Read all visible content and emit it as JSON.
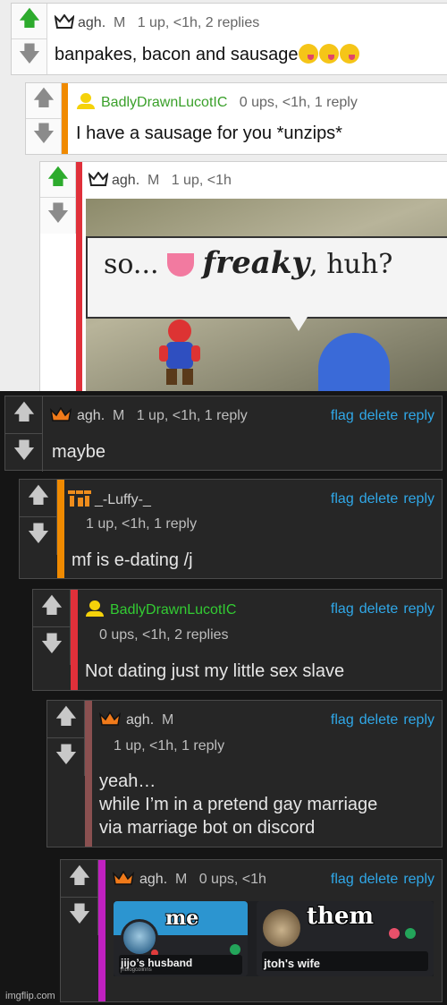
{
  "light_comments": [
    {
      "user": "agh.",
      "mod": "M",
      "meta": "1 up, <1h, 2 replies",
      "text": "banpakes, bacon and sausage"
    },
    {
      "user": "BadlyDrawnLucotIC",
      "meta": "0 ups, <1h, 1 reply",
      "text": "I have a sausage for you *unzips*"
    },
    {
      "user": "agh.",
      "mod": "M",
      "meta": "1 up, <1h",
      "meme_text_a": "so...",
      "meme_text_b": "freaky",
      "meme_text_c": ", huh?"
    }
  ],
  "dark_comments": [
    {
      "user": "agh.",
      "mod": "M",
      "meta": "1 up, <1h, 1 reply",
      "text": "maybe"
    },
    {
      "user": "_-Luffy-_",
      "meta": "1 up, <1h, 1 reply",
      "text": "mf is e-dating /j"
    },
    {
      "user": "BadlyDrawnLucotIC",
      "meta": "0 ups, <1h, 2 replies",
      "text": "Not dating just my little sex slave"
    },
    {
      "user": "agh.",
      "mod": "M",
      "meta": "1 up, <1h, 1 reply",
      "text_lines": [
        "yeah…",
        "while I’m in a pretend gay marriage",
        "via marriage bot on discord"
      ]
    },
    {
      "user": "agh.",
      "mod": "M",
      "meta": "0 ups, <1h"
    }
  ],
  "actions": {
    "flag": "flag",
    "delete": "delete",
    "reply": "reply"
  },
  "discord": {
    "left_label": "me",
    "left_name": "jijo’s husband",
    "left_sub": "jhbiogcolinns",
    "right_label": "them",
    "right_name": "jtoh's wife"
  },
  "watermark": "imgflip.com",
  "colors": {
    "upvote_green": "#2dab2d",
    "stripe_orange": "#f08a00",
    "stripe_red": "#e0303a",
    "stripe_brown": "#8a5050",
    "stripe_magenta": "#c020c0",
    "link_blue": "#30a8e8",
    "username_green": "#33cc33"
  }
}
